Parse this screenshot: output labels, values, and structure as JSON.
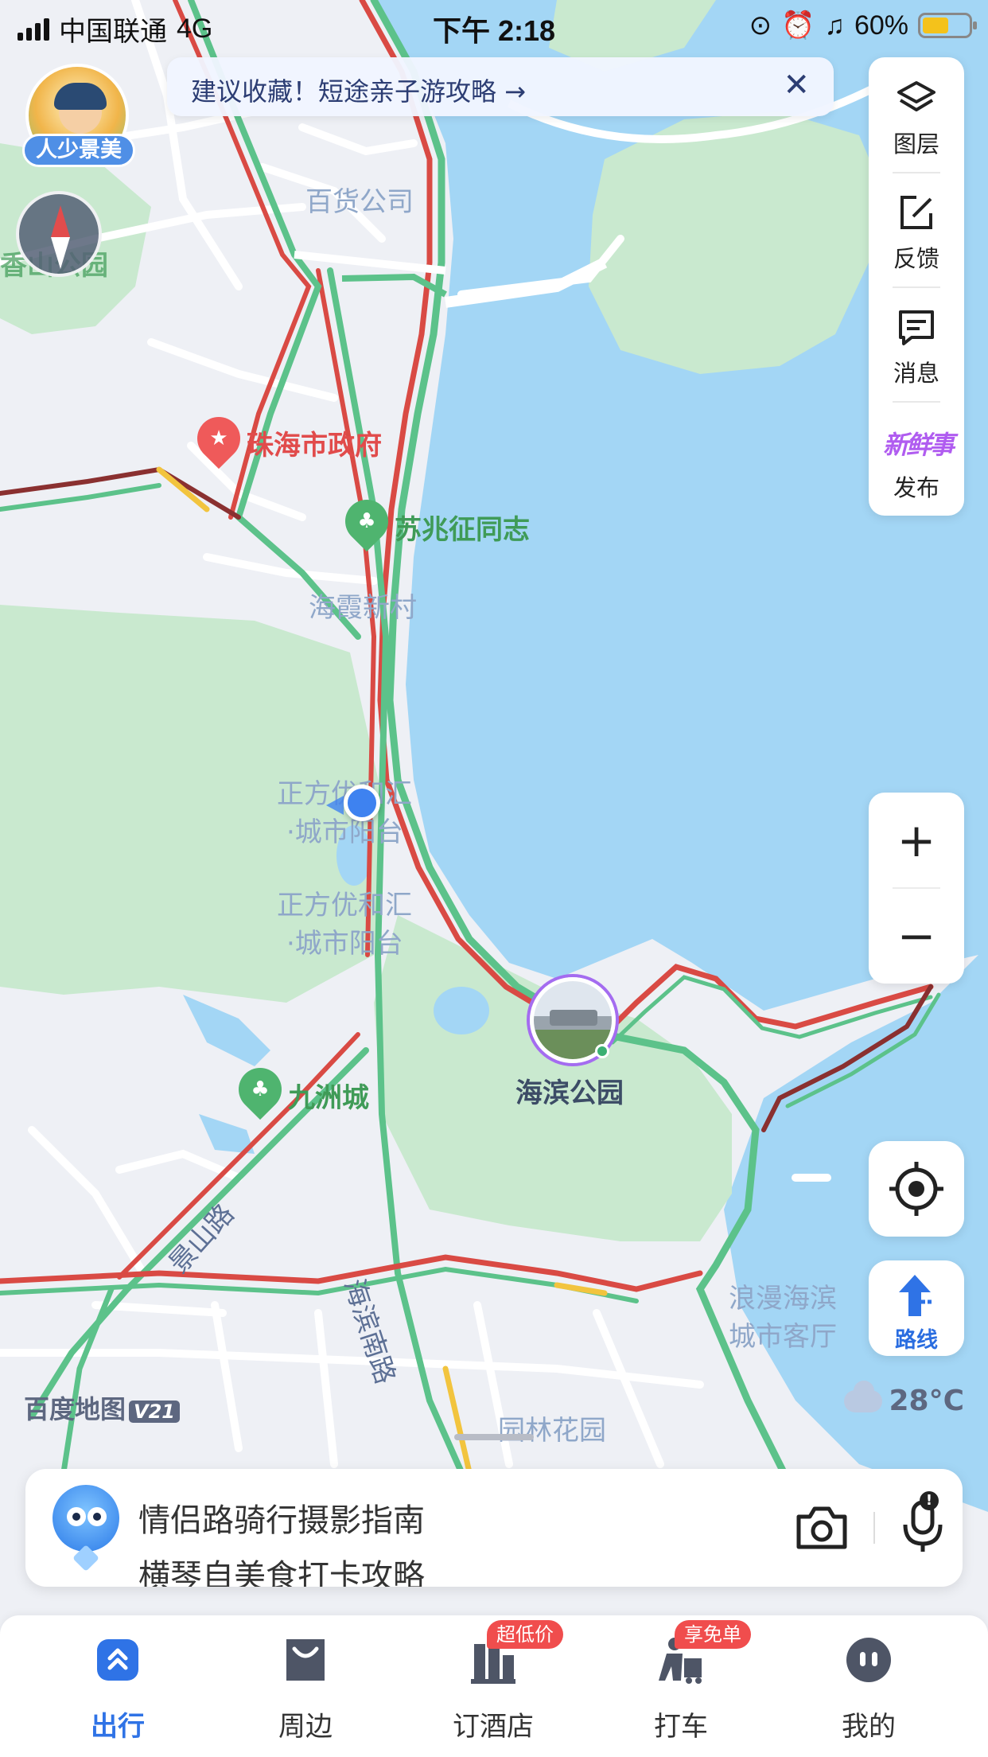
{
  "status_bar": {
    "carrier": "中国联通",
    "network": "4G",
    "time": "下午 2:18",
    "battery": "60%"
  },
  "banner": {
    "text": "建议收藏！短途亲子游攻略 →",
    "close": "✕"
  },
  "avatar": {
    "badge": "人少景美"
  },
  "right_panel": {
    "items": [
      {
        "label": "图层",
        "icon": "layers-icon"
      },
      {
        "label": "反馈",
        "icon": "feedback-icon"
      },
      {
        "label": "消息",
        "icon": "message-icon"
      },
      {
        "label": "发布",
        "icon": "fresh-news-icon",
        "icon_text": "新鲜事"
      }
    ]
  },
  "map": {
    "labels": {
      "baihuo": "百货公司",
      "xiangshan": "香山公园",
      "zhengfu": "珠海市政府",
      "suzhaozheng": "苏兆征同志",
      "haixia": "海霞新村",
      "zhengfang1_l1": "正方优和汇",
      "zhengfang1_l2": "·城市阳台",
      "zhengfang2_l1": "正方优和汇",
      "zhengfang2_l2": "·城市阳台",
      "haibin_park": "海滨公园",
      "jiuzhou": "九洲城",
      "jingshan": "景山路",
      "haibin_road": "海滨南路",
      "langman_l1": "浪漫海滨",
      "langman_l2": "城市客厅",
      "yuanlin": "园林花园"
    }
  },
  "zoom": {
    "in": "+",
    "out": "−"
  },
  "route": {
    "label": "路线"
  },
  "brand": {
    "name": "百度地图",
    "version": "V21"
  },
  "weather": {
    "temp": "28°C",
    "icon": "cloud-icon"
  },
  "search": {
    "line1": "情侣路骑行摄影指南",
    "line2": "横琴自美食打卡攻略"
  },
  "tabs": [
    {
      "label": "出行",
      "active": true,
      "icon": "travel-icon"
    },
    {
      "label": "周边",
      "active": false,
      "icon": "nearby-icon"
    },
    {
      "label": "订酒店",
      "active": false,
      "icon": "hotel-icon",
      "tag": "超低价"
    },
    {
      "label": "打车",
      "active": false,
      "icon": "taxi-icon",
      "tag": "享免单"
    },
    {
      "label": "我的",
      "active": false,
      "icon": "profile-icon"
    }
  ],
  "colors": {
    "water": "#a3d6f5",
    "park": "#c9e9cf",
    "land": "#eef0f5",
    "traffic_red": "#d94a44",
    "traffic_green": "#5cc28a",
    "traffic_yellow": "#f2c43e",
    "accent": "#2f73e6"
  }
}
